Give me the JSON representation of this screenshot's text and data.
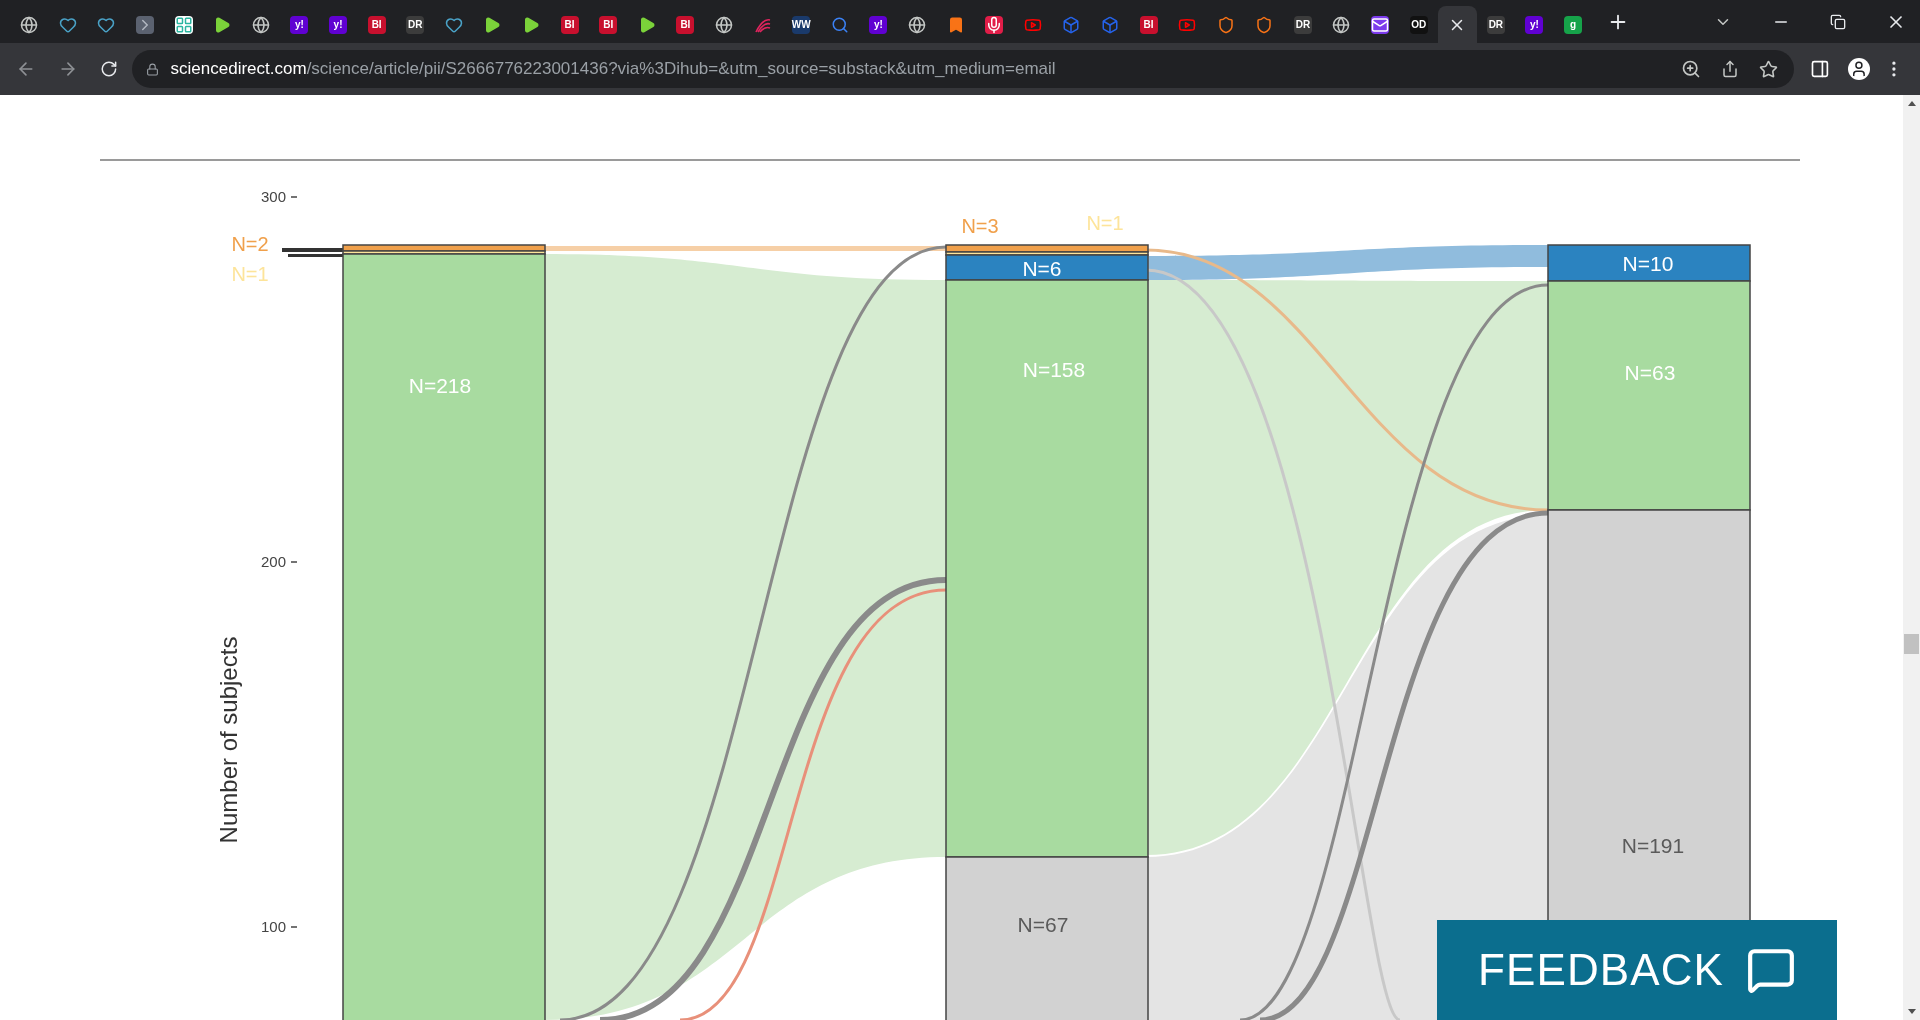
{
  "tabs": [
    {
      "kind": "globe",
      "selected": false
    },
    {
      "kind": "heart",
      "selected": false
    },
    {
      "kind": "heart",
      "selected": false
    },
    {
      "kind": "chevron",
      "selected": false
    },
    {
      "kind": "grid",
      "selected": false
    },
    {
      "kind": "play",
      "selected": false
    },
    {
      "kind": "globe",
      "selected": false
    },
    {
      "kind": "letters",
      "glyph": "y!",
      "color": "#6001d2",
      "selected": false
    },
    {
      "kind": "letters",
      "glyph": "y!",
      "color": "#6001d2",
      "selected": false
    },
    {
      "kind": "letters",
      "glyph": "BI",
      "color": "#c8102e",
      "selected": false
    },
    {
      "kind": "letters",
      "glyph": "DR",
      "color": "#3c3c3c",
      "selected": false
    },
    {
      "kind": "heart",
      "selected": false
    },
    {
      "kind": "play",
      "selected": false
    },
    {
      "kind": "play",
      "selected": false
    },
    {
      "kind": "letters",
      "glyph": "BI",
      "color": "#c8102e",
      "selected": false
    },
    {
      "kind": "letters",
      "glyph": "BI",
      "color": "#c8102e",
      "selected": false
    },
    {
      "kind": "play",
      "selected": false
    },
    {
      "kind": "letters",
      "glyph": "BI",
      "color": "#c8102e",
      "selected": false
    },
    {
      "kind": "globe",
      "selected": false
    },
    {
      "kind": "swirl",
      "selected": false
    },
    {
      "kind": "letters",
      "glyph": "WW",
      "color": "#1a3a6b",
      "selected": false
    },
    {
      "kind": "search",
      "selected": false
    },
    {
      "kind": "letters",
      "glyph": "y!",
      "color": "#6001d2",
      "selected": false
    },
    {
      "kind": "globe",
      "selected": false
    },
    {
      "kind": "bookmark",
      "selected": false
    },
    {
      "kind": "mic",
      "selected": false
    },
    {
      "kind": "youtube",
      "selected": false
    },
    {
      "kind": "cube",
      "selected": false
    },
    {
      "kind": "cube",
      "selected": false
    },
    {
      "kind": "letters",
      "glyph": "BI",
      "color": "#c8102e",
      "selected": false
    },
    {
      "kind": "youtube",
      "selected": false
    },
    {
      "kind": "shield",
      "selected": false
    },
    {
      "kind": "shield",
      "selected": false
    },
    {
      "kind": "letters",
      "glyph": "DR",
      "color": "#3c3c3c",
      "selected": false
    },
    {
      "kind": "globe",
      "selected": false
    },
    {
      "kind": "mail",
      "selected": false
    },
    {
      "kind": "letters",
      "glyph": "OD",
      "color": "#111111",
      "selected": false
    },
    {
      "kind": "blank",
      "selected": true
    },
    {
      "kind": "letters",
      "glyph": "DR",
      "color": "#3c3c3c",
      "selected": false
    },
    {
      "kind": "letters",
      "glyph": "y!",
      "color": "#6001d2",
      "selected": false
    },
    {
      "kind": "letters",
      "glyph": "g",
      "color": "#16a34a",
      "selected": false
    }
  ],
  "address_bar": {
    "host": "sciencedirect.com",
    "path": "/science/article/pii/S2666776223001436?via%3Dihub=&utm_source=substack&utm_medium=email"
  },
  "figure": {
    "ylabel": "Number of subjects",
    "yticks": [
      "300",
      "200",
      "100"
    ],
    "columns": [
      {
        "nodes": [
          {
            "label": "N=2",
            "color": "#f0a04b"
          },
          {
            "label": "N=1",
            "color": "#fde49a"
          },
          {
            "label": "N=218",
            "color": "#a8dba0"
          }
        ]
      },
      {
        "nodes": [
          {
            "label": "N=3",
            "color": "#f0a04b"
          },
          {
            "label": "N=1",
            "color": "#fde49a"
          },
          {
            "label": "N=6",
            "color": "#2b83c0"
          },
          {
            "label": "N=158",
            "color": "#a8dba0"
          },
          {
            "label": "N=67",
            "color": "#d2d2d2"
          }
        ]
      },
      {
        "nodes": [
          {
            "label": "N=10",
            "color": "#2b83c0"
          },
          {
            "label": "N=63",
            "color": "#a8dba0"
          },
          {
            "label": "N=191",
            "color": "#d2d2d2"
          }
        ]
      }
    ]
  },
  "feedback_button": {
    "label": "FEEDBACK"
  }
}
